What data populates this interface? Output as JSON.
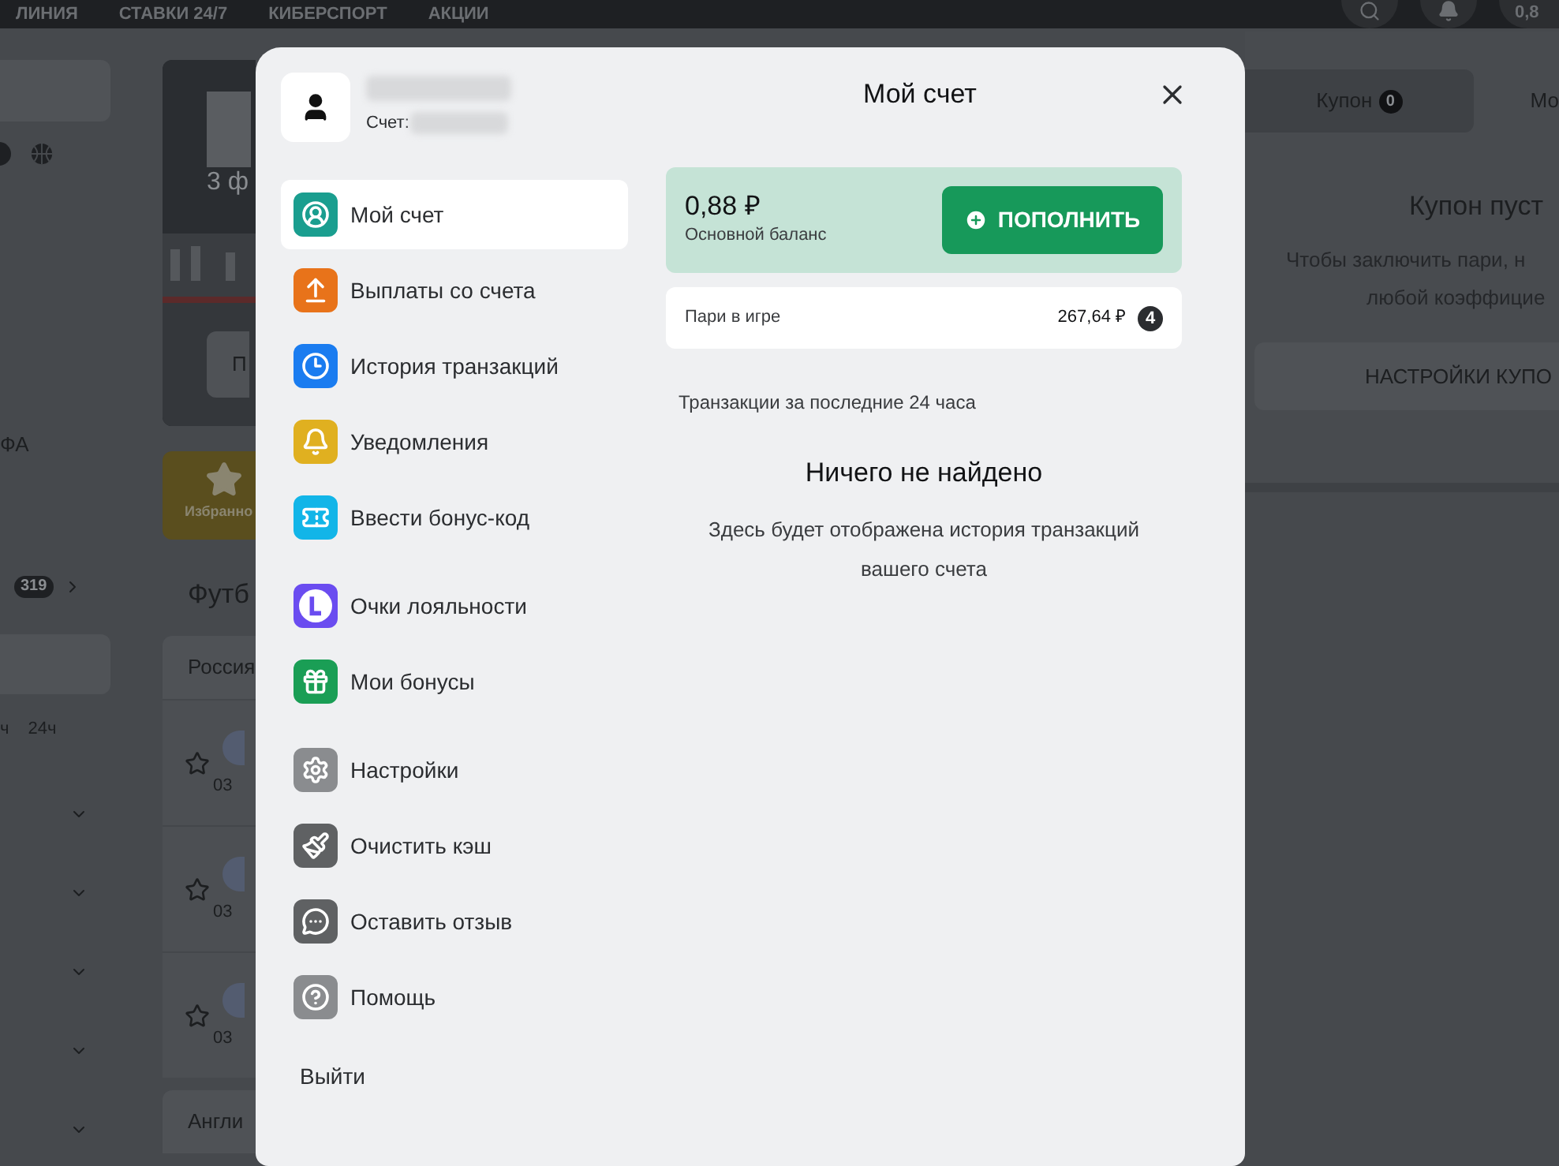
{
  "top_nav": {
    "items": [
      "ЛИНИЯ",
      "СТАВКИ 24/7",
      "КИБЕРСПОРТ",
      "АКЦИИ"
    ],
    "balance": "0,8"
  },
  "left_column": {
    "sport_text": "ФА",
    "count": "319",
    "time_filters": [
      "ч",
      "24ч"
    ]
  },
  "middle_column": {
    "banner_text": "3 ф",
    "banner_button": "П",
    "favorites": "Избранно",
    "section_title": "Футб",
    "leagues": [
      "Россия",
      "Англи"
    ],
    "match_times": [
      "03",
      "03",
      "03"
    ]
  },
  "coupon_panel": {
    "tabs": [
      {
        "label": "Купон",
        "count": "0",
        "selected": true
      },
      {
        "label": "Мо",
        "selected": false
      }
    ],
    "title": "Купон пуст",
    "lines": [
      "Чтобы заключить пари, н",
      "любой коэффицие"
    ],
    "settings_button": "НАСТРОЙКИ КУПО"
  },
  "modal": {
    "title": "Мой счет",
    "account_label": "Счет:",
    "menu_groups": [
      [
        {
          "label": "Мой счет",
          "kind": "user",
          "color": "#1a9e8f",
          "selected": true
        },
        {
          "label": "Выплаты со счета",
          "kind": "upload",
          "color": "#e8731a",
          "selected": false
        },
        {
          "label": "История транзакций",
          "kind": "clock",
          "color": "#1a7cf0",
          "selected": false
        },
        {
          "label": "Уведомления",
          "kind": "bell",
          "color": "#e0b020",
          "selected": false
        },
        {
          "label": "Ввести бонус-код",
          "kind": "ticket",
          "color": "#12b5e8",
          "selected": false
        }
      ],
      [
        {
          "label": "Очки лояльности",
          "kind": "loyalty",
          "color": "#6a4cf0",
          "selected": false
        },
        {
          "label": "Мои бонусы",
          "kind": "gift",
          "color": "#1a9e55",
          "selected": false
        }
      ],
      [
        {
          "label": "Настройки",
          "kind": "gear",
          "color": "#8a8c8f",
          "selected": false
        },
        {
          "label": "Очистить кэш",
          "kind": "broom",
          "color": "#5f6163",
          "selected": false
        },
        {
          "label": "Оставить отзыв",
          "kind": "chat",
          "color": "#5f6163",
          "selected": false
        },
        {
          "label": "Помощь",
          "kind": "help",
          "color": "#8a8c8f",
          "selected": false
        }
      ]
    ],
    "logout": "Выйти",
    "balance": {
      "amount": "0,88 ₽",
      "label": "Основной баланс",
      "deposit_button": "ПОПОЛНИТЬ"
    },
    "bets": {
      "label": "Пари в игре",
      "amount": "267,64 ₽",
      "count": "4"
    },
    "transactions_title": "Транзакции за последние 24 часа",
    "empty_title": "Ничего не найдено",
    "empty_text": "Здесь будет отображена история транзакций вашего счета"
  }
}
